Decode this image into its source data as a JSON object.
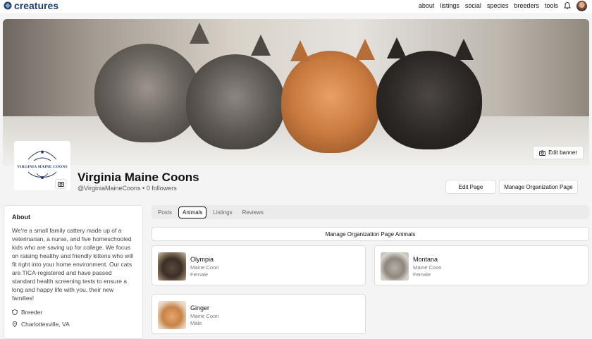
{
  "brand": {
    "name": "creatures",
    "color": "#1d3f73"
  },
  "nav": {
    "items": [
      "about",
      "listings",
      "social",
      "species",
      "breeders",
      "tools"
    ]
  },
  "banner": {
    "edit_label": "Edit banner"
  },
  "org_logo": {
    "text": "VIRGINIA MAINE COONS"
  },
  "org": {
    "name": "Virginia Maine Coons",
    "handle": "@VirginiaMaineCoons",
    "followers": "0 followers"
  },
  "actions": {
    "edit_page": "Edit Page",
    "manage_org_page": "Manage Organization Page"
  },
  "about": {
    "title": "About",
    "text": "We're a small family cattery made up of a veterinarian, a nurse, and five homeschooled kids who are saving up for college. We focus on raising healthy and friendly kittens who will fit right into your home environment. Our cats are TICA-registered and have passed standard health screening tests to ensure a long and happy life with you, their new families!",
    "type": "Breeder",
    "location": "Charlottesville, VA"
  },
  "tabs": [
    "Posts",
    "Animals",
    "Listings",
    "Reviews"
  ],
  "active_tab": "Animals",
  "manage_animals_label": "Manage Organization Page Animals",
  "animals": [
    {
      "name": "Olympia",
      "breed": "Maine Coon",
      "sex": "Female"
    },
    {
      "name": "Montana",
      "breed": "Maine Coon",
      "sex": "Female"
    },
    {
      "name": "Ginger",
      "breed": "Maine Coon",
      "sex": "Male"
    }
  ]
}
